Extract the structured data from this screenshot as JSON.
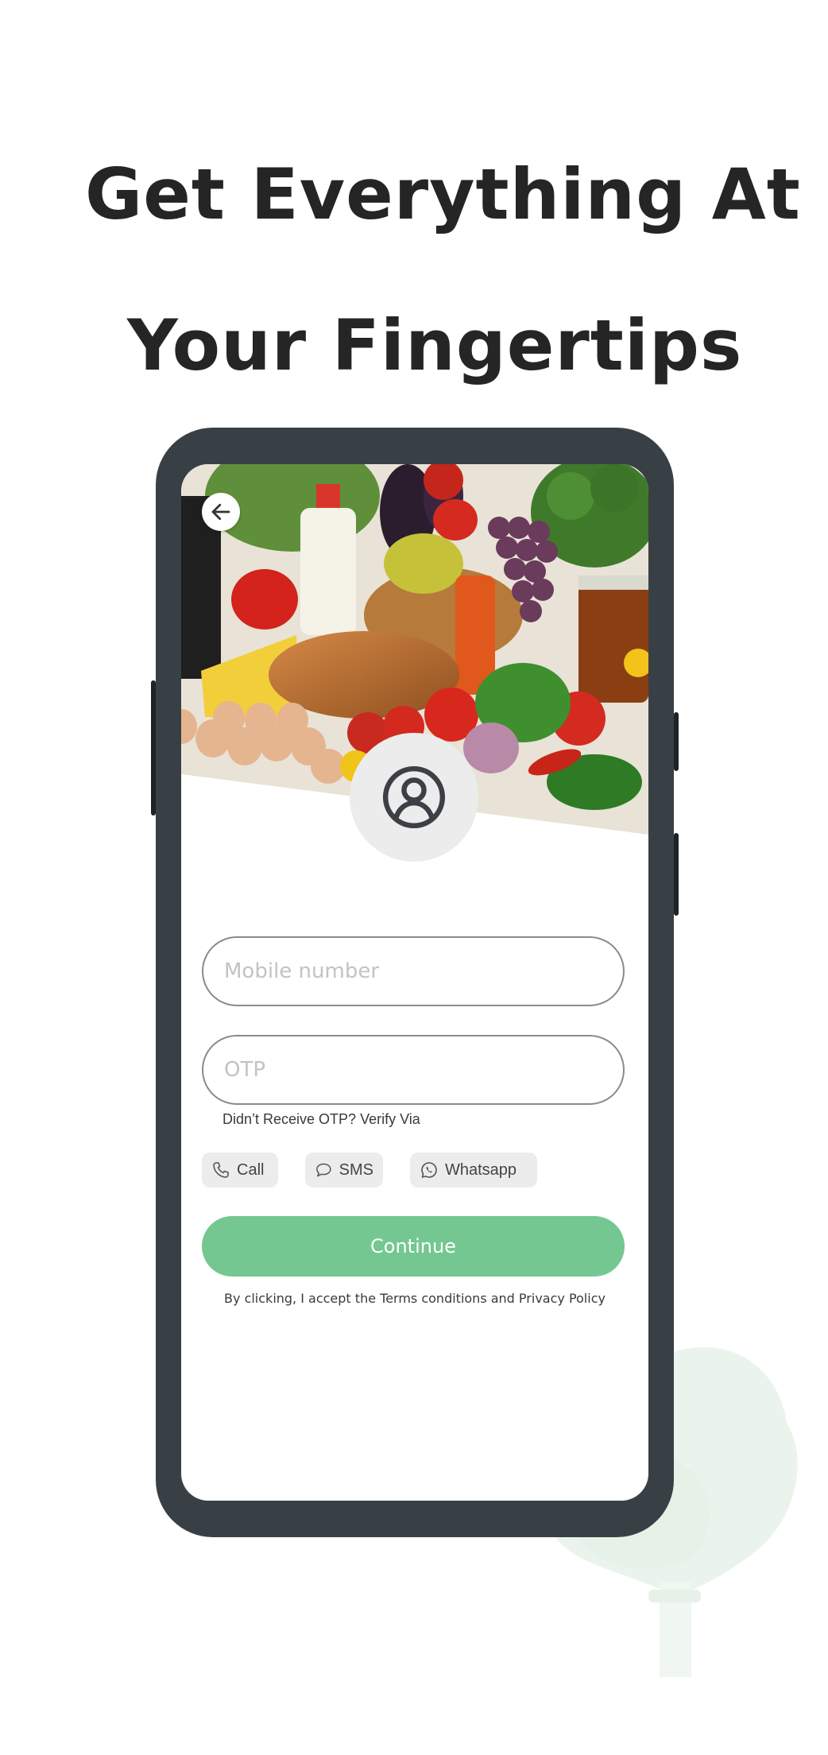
{
  "headline": {
    "line1": "Get Everything At",
    "line2": "Your Fingertips"
  },
  "icons": {
    "back": "arrow-left-icon",
    "avatar": "user-circle-icon",
    "call": "phone-icon",
    "sms": "chat-bubble-icon",
    "whatsapp": "whatsapp-icon"
  },
  "form": {
    "mobile_placeholder": "Mobile number",
    "otp_placeholder": "OTP",
    "otp_hint": "Didn’t Receive OTP? Verify Via",
    "verify_options": {
      "call": "Call",
      "sms": "SMS",
      "whatsapp": "Whatsapp"
    },
    "continue_label": "Continue",
    "terms_text": "By clicking, I accept the Terms conditions and Privacy Policy"
  },
  "colors": {
    "headline": "#252525",
    "phone_frame": "#394045",
    "primary_button": "#74c791",
    "chip_bg": "#ececec"
  }
}
